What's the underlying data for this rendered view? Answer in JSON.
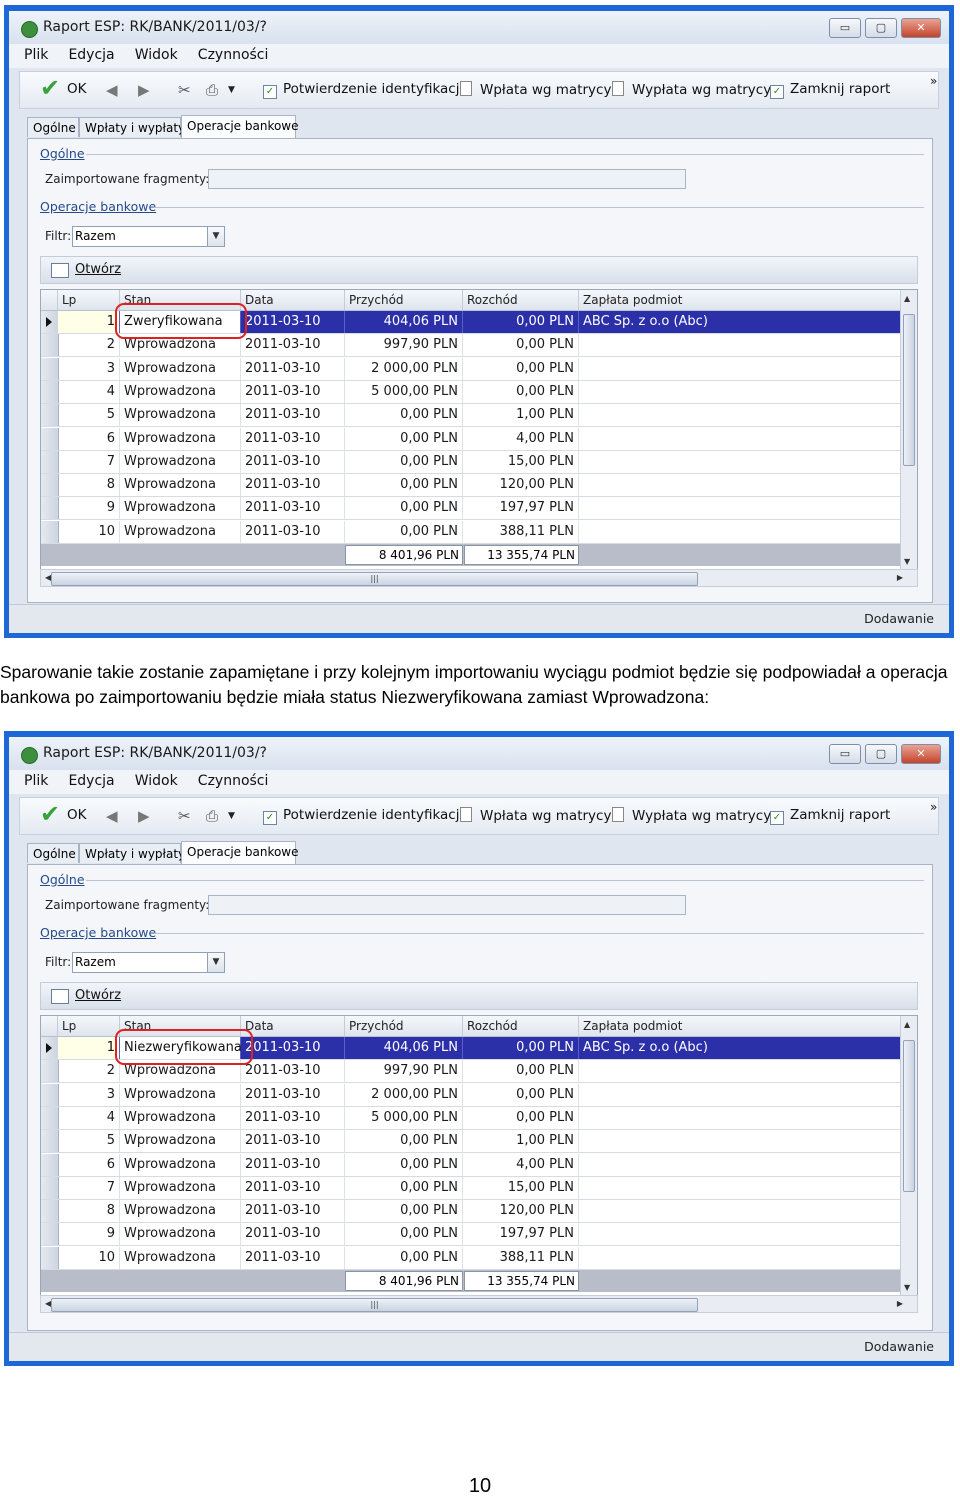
{
  "window": {
    "title": "Raport ESP: RK/BANK/2011/03/?",
    "buttons": {
      "minimize": "▭",
      "maximize": "▢",
      "close": "✕"
    }
  },
  "menu": [
    "Plik",
    "Edycja",
    "Widok",
    "Czynności"
  ],
  "toolbar": {
    "ok": "OK",
    "confirm": "Potwierdzenie identyfikacji",
    "deposit": "Wpłata wg matrycy",
    "withdrawal": "Wypłata wg matrycy",
    "close_report": "Zamknij raport",
    "more": "»"
  },
  "tabs": [
    "Ogólne",
    "Wpłaty i wypłaty",
    "Operacje bankowe"
  ],
  "form": {
    "section_general": "Ogólne",
    "imported_label": "Zaimportowane fragmenty:",
    "section_operations": "Operacje bankowe",
    "filter_label": "Filtr:",
    "filter_value": "Razem",
    "open_label": "Otwórz"
  },
  "grid": {
    "columns": [
      "Lp",
      "Stan",
      "Data",
      "Przychód",
      "Rozchód",
      "Zapłata podmiot"
    ],
    "rows": [
      {
        "lp": "1",
        "stan": "Zweryfikowana",
        "data": "2011-03-10",
        "przychod": "404,06 PLN",
        "rozchod": "0,00 PLN",
        "podmiot": "ABC Sp. z o.o (Abc)"
      },
      {
        "lp": "2",
        "stan": "Wprowadzona",
        "data": "2011-03-10",
        "przychod": "997,90 PLN",
        "rozchod": "0,00 PLN",
        "podmiot": ""
      },
      {
        "lp": "3",
        "stan": "Wprowadzona",
        "data": "2011-03-10",
        "przychod": "2 000,00 PLN",
        "rozchod": "0,00 PLN",
        "podmiot": ""
      },
      {
        "lp": "4",
        "stan": "Wprowadzona",
        "data": "2011-03-10",
        "przychod": "5 000,00 PLN",
        "rozchod": "0,00 PLN",
        "podmiot": ""
      },
      {
        "lp": "5",
        "stan": "Wprowadzona",
        "data": "2011-03-10",
        "przychod": "0,00 PLN",
        "rozchod": "1,00 PLN",
        "podmiot": ""
      },
      {
        "lp": "6",
        "stan": "Wprowadzona",
        "data": "2011-03-10",
        "przychod": "0,00 PLN",
        "rozchod": "4,00 PLN",
        "podmiot": ""
      },
      {
        "lp": "7",
        "stan": "Wprowadzona",
        "data": "2011-03-10",
        "przychod": "0,00 PLN",
        "rozchod": "15,00 PLN",
        "podmiot": ""
      },
      {
        "lp": "8",
        "stan": "Wprowadzona",
        "data": "2011-03-10",
        "przychod": "0,00 PLN",
        "rozchod": "120,00 PLN",
        "podmiot": ""
      },
      {
        "lp": "9",
        "stan": "Wprowadzona",
        "data": "2011-03-10",
        "przychod": "0,00 PLN",
        "rozchod": "197,97 PLN",
        "podmiot": ""
      },
      {
        "lp": "10",
        "stan": "Wprowadzona",
        "data": "2011-03-10",
        "przychod": "0,00 PLN",
        "rozchod": "388,11 PLN",
        "podmiot": ""
      }
    ],
    "sum_przychod": "8 401,96 PLN",
    "sum_rozchod": "13 355,74 PLN"
  },
  "second_first_row_stan": "Niezweryfikowana",
  "status": "Dodawanie",
  "caption": "Sparowanie takie zostanie zapamiętane i przy kolejnym importowaniu wyciągu podmiot będzie się podpowiadał a operacja bankowa po zaimportowaniu będzie miała status Niezweryfikowana zamiast Wprowadzona:",
  "page_number": "10"
}
